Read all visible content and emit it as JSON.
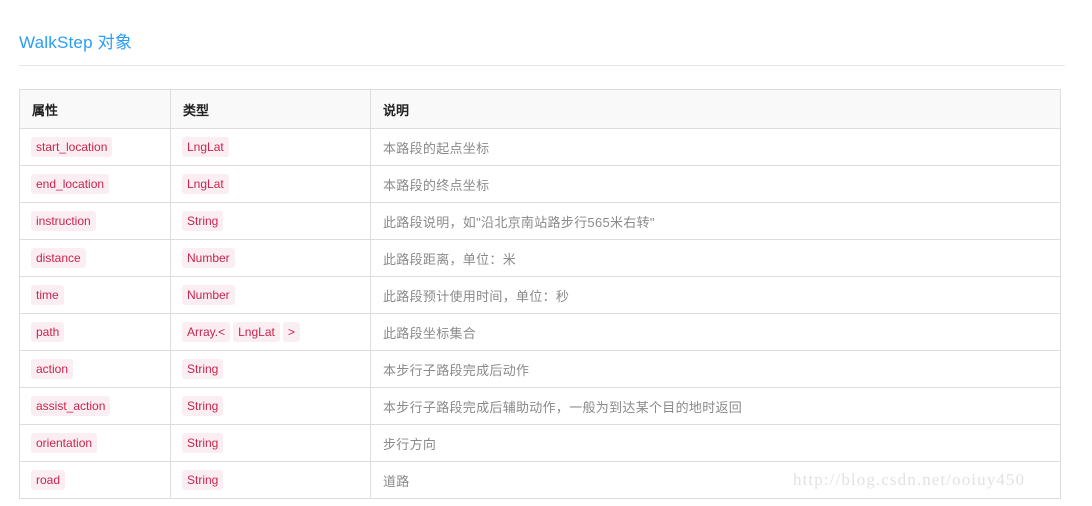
{
  "page": {
    "title": "WalkStep 对象",
    "title_color": "#2a9df4",
    "background_color": "#ffffff",
    "watermark": "http://blog.csdn.net/ooiuy450"
  },
  "table": {
    "headers": {
      "attribute": "属性",
      "type": "类型",
      "description": "说明"
    },
    "header_background": "#f9f9f9",
    "border_color": "#dddddd",
    "code_text_color": "#c7254e",
    "code_background_color": "#fbeef2",
    "description_text_color": "#8a8a8a",
    "rows": [
      {
        "attribute": "start_location",
        "type": "LngLat",
        "type_parts": [
          "LngLat"
        ],
        "description": "本路段的起点坐标"
      },
      {
        "attribute": "end_location",
        "type": "LngLat",
        "type_parts": [
          "LngLat"
        ],
        "description": "本路段的终点坐标"
      },
      {
        "attribute": "instruction",
        "type": "String",
        "type_parts": [
          "String"
        ],
        "description": "此路段说明，如\"沿北京南站路步行565米右转\""
      },
      {
        "attribute": "distance",
        "type": "Number",
        "type_parts": [
          "Number"
        ],
        "description": "此路段距离，单位：米"
      },
      {
        "attribute": "time",
        "type": "Number",
        "type_parts": [
          "Number"
        ],
        "description": "此路段预计使用时间，单位：秒"
      },
      {
        "attribute": "path",
        "type": "Array.< LngLat >",
        "type_parts": [
          "Array.<",
          "LngLat",
          ">"
        ],
        "description": "此路段坐标集合"
      },
      {
        "attribute": "action",
        "type": "String",
        "type_parts": [
          "String"
        ],
        "description": "本步行子路段完成后动作"
      },
      {
        "attribute": "assist_action",
        "type": "String",
        "type_parts": [
          "String"
        ],
        "description": "本步行子路段完成后辅助动作，一般为到达某个目的地时返回"
      },
      {
        "attribute": "orientation",
        "type": "String",
        "type_parts": [
          "String"
        ],
        "description": "步行方向"
      },
      {
        "attribute": "road",
        "type": "String",
        "type_parts": [
          "String"
        ],
        "description": "道路"
      }
    ]
  }
}
